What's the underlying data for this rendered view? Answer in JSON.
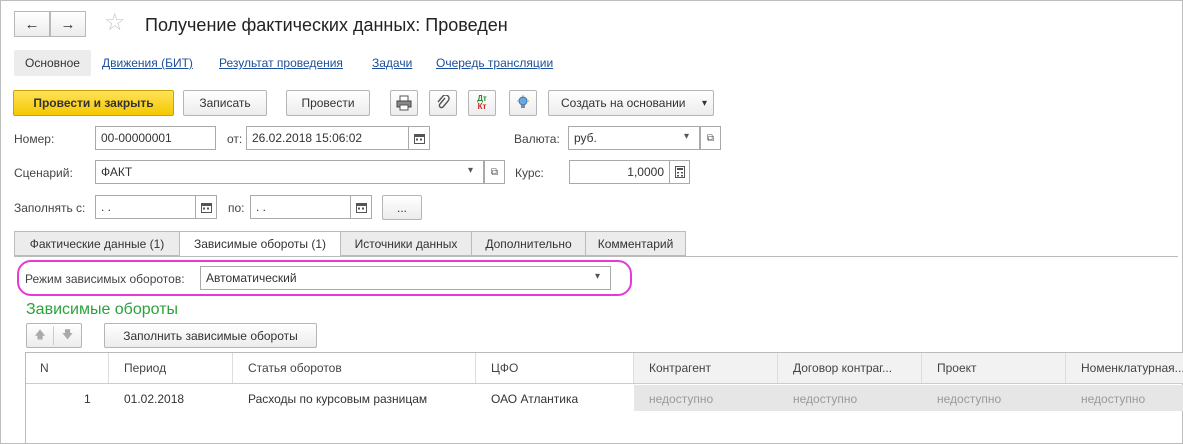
{
  "window": {
    "title": "Получение фактических данных: Проведен"
  },
  "nav": {
    "back_glyph": "←",
    "forward_glyph": "→",
    "favorite_glyph": "☆"
  },
  "tabs": [
    {
      "label": "Основное",
      "active": true
    },
    {
      "label": "Движения (БИТ)"
    },
    {
      "label": "Результат проведения"
    },
    {
      "label": "Задачи"
    },
    {
      "label": "Очередь трансляции"
    }
  ],
  "toolbar": {
    "post_close": "Провести и закрыть",
    "save": "Записать",
    "post": "Провести",
    "create_based": "Создать на основании",
    "create_based_arrow": "▾",
    "dtkt_top": "Дт",
    "dtkt_bottom": "Кт"
  },
  "form": {
    "number_label": "Номер:",
    "number_value": "00-00000001",
    "from_label": "от:",
    "date_value": "26.02.2018 15:06:02",
    "currency_label": "Валюта:",
    "currency_value": "руб.",
    "scenario_label": "Сценарий:",
    "scenario_value": "ФАКТ",
    "rate_label": "Курс:",
    "rate_value": "1,0000",
    "fill_from_label": "Заполнять с:",
    "fill_from_value": " .  .",
    "to_label": "по:",
    "to_value": " .  .",
    "more_button": "...",
    "dropdown_arrow": "▾",
    "open_glyph": "⧉"
  },
  "form_tabs": [
    {
      "label": "Фактические данные (1)"
    },
    {
      "label": "Зависимые обороты (1)",
      "active": true
    },
    {
      "label": "Источники данных"
    },
    {
      "label": "Дополнительно"
    },
    {
      "label": "Комментарий"
    }
  ],
  "dependent": {
    "mode_label": "Режим зависимых оборотов:",
    "mode_value": "Автоматический",
    "section_title": "Зависимые обороты",
    "fill_button": "Заполнить зависимые обороты",
    "up_glyph": "🡅",
    "down_glyph": "🡇"
  },
  "table": {
    "columns": [
      "N",
      "Период",
      "Статья оборотов",
      "ЦФО",
      "Контрагент",
      "Договор контраг...",
      "Проект",
      "Номенклатурная..."
    ],
    "rows": [
      {
        "n": "1",
        "period": "01.02.2018",
        "article": "Расходы по курсовым разницам",
        "cfo": "ОАО Атлантика",
        "contractor": "недоступно",
        "contract": "недоступно",
        "project": "недоступно",
        "nomenclature": "недоступно"
      }
    ]
  }
}
